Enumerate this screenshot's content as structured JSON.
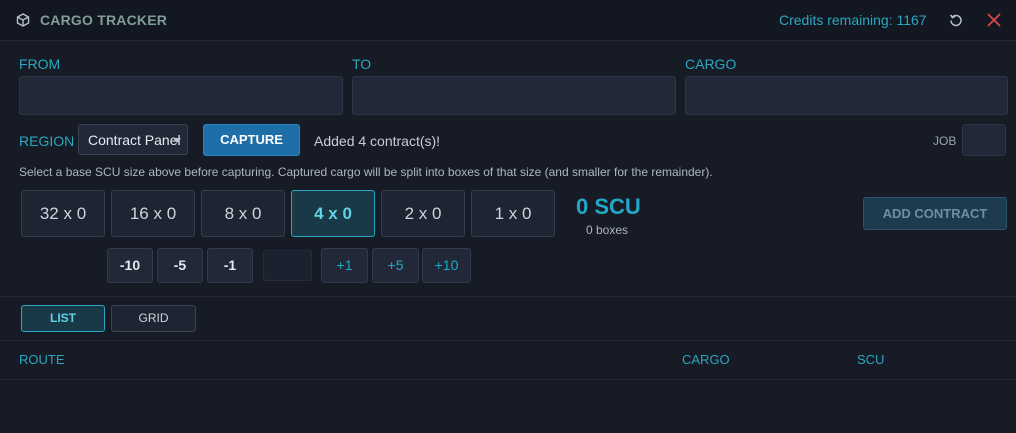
{
  "app": {
    "title": "CARGO TRACKER",
    "credits": "Credits remaining: 1167",
    "icons": {
      "logo": "cube-icon",
      "refresh": "refresh-icon",
      "close": "close-icon"
    }
  },
  "fields": {
    "from": {
      "label": "FROM",
      "value": ""
    },
    "to": {
      "label": "TO",
      "value": ""
    },
    "cargo": {
      "label": "CARGO",
      "value": ""
    }
  },
  "controls": {
    "region_label": "REGION",
    "region_value": "Contract Panel",
    "capture_label": "CAPTURE",
    "status": "Added 4 contract(s)!",
    "job_label": "JOB",
    "job_value": ""
  },
  "hint": "Select a base SCU size above before capturing. Captured cargo will be split into boxes of that size (and smaller for the remainder).",
  "scu_sizes": [
    "32 x 0",
    "16 x 0",
    "8 x 0",
    "4 x 0",
    "2 x 0",
    "1 x 0"
  ],
  "scu_selected": "4 x 0",
  "summary": {
    "total": "0 SCU",
    "boxes": "0 boxes"
  },
  "add_contract_label": "ADD CONTRACT",
  "adjust": {
    "minus": [
      "-10",
      "-5",
      "-1"
    ],
    "plus": [
      "+1",
      "+5",
      "+10"
    ],
    "value": ""
  },
  "view": {
    "list_label": "LIST",
    "grid_label": "GRID",
    "selected": "LIST"
  },
  "table": {
    "columns": [
      "ROUTE",
      "CARGO",
      "SCU"
    ]
  },
  "colors": {
    "accent": "#2aa7c0",
    "background": "#171b26",
    "close": "#d9464a",
    "primary_button": "#1e6fa8"
  }
}
